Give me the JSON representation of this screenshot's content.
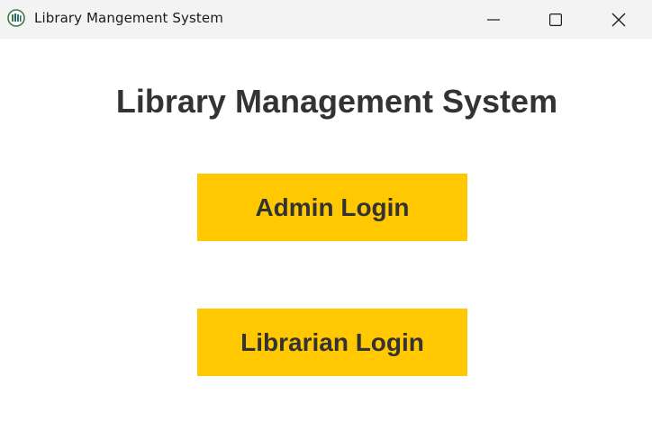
{
  "window": {
    "title": "Library Mangement System",
    "controls": {
      "minimize": "minimize-icon",
      "maximize": "maximize-icon",
      "close": "close-icon"
    },
    "app_icon": "library-app-icon"
  },
  "main": {
    "heading": "Library Management System",
    "buttons": {
      "admin_login": "Admin Login",
      "librarian_login": "Librarian Login"
    }
  },
  "colors": {
    "titlebar_bg": "#f3f3f3",
    "button_bg": "#ffc800",
    "text": "#333333",
    "window_bg": "#ffffff"
  }
}
